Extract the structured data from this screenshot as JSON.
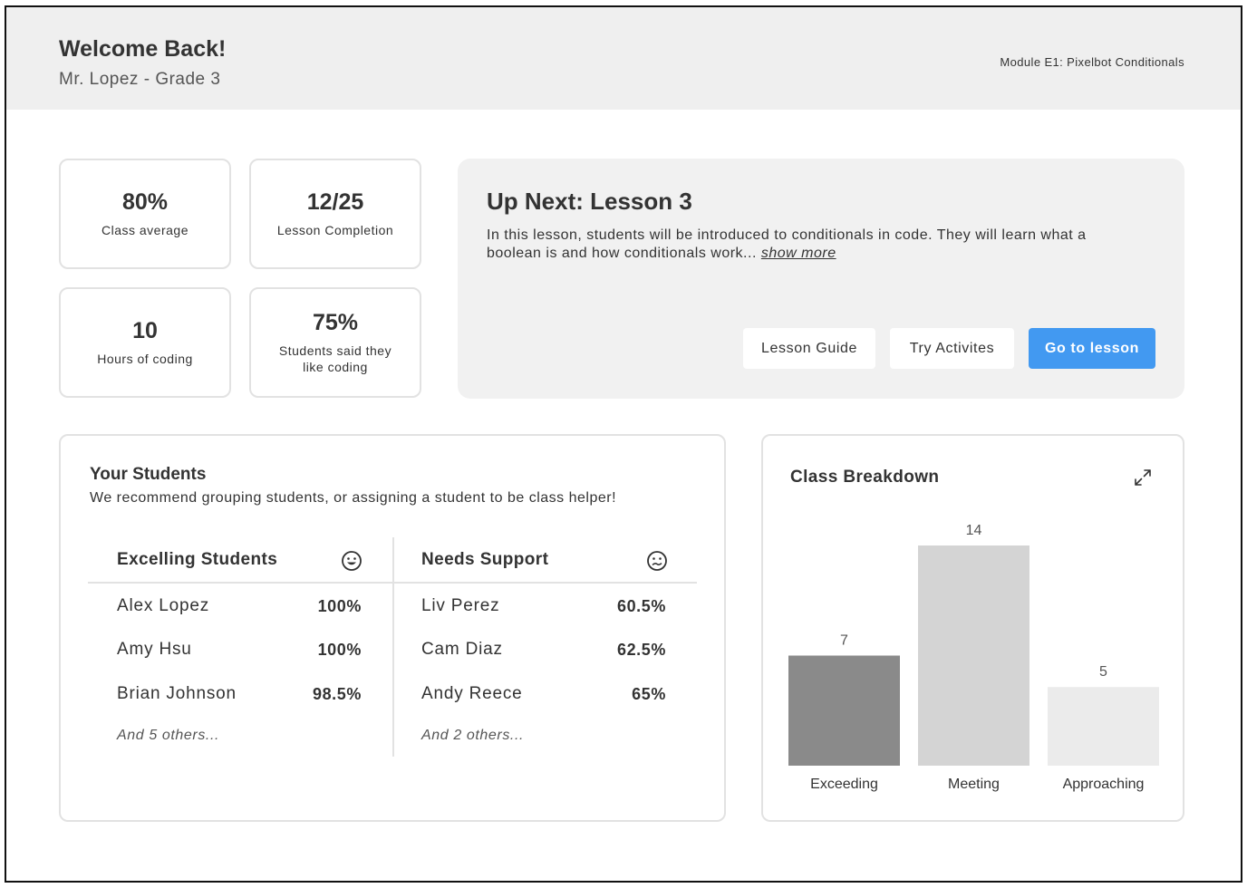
{
  "header": {
    "welcome": "Welcome Back!",
    "subtitle": "Mr. Lopez - Grade 3",
    "module": "Module E1: Pixelbot Conditionals"
  },
  "stats": [
    {
      "value": "80%",
      "label": "Class average"
    },
    {
      "value": "12/25",
      "label": "Lesson Completion"
    },
    {
      "value": "10",
      "label": "Hours of coding"
    },
    {
      "value": "75%",
      "label": "Students said they like coding"
    }
  ],
  "up_next": {
    "title": "Up Next: Lesson 3",
    "description": "In this lesson, students will be introduced to conditionals in code. They will learn what a boolean is and how conditionals work...",
    "show_more": "show more",
    "buttons": {
      "lesson_guide": "Lesson Guide",
      "try_activities": "Try Activites",
      "go_to_lesson": "Go to lesson"
    },
    "primary_color": "#4299f1"
  },
  "students": {
    "title": "Your Students",
    "subtitle": "We recommend grouping students, or assigning a student to be class helper!",
    "excelling": {
      "title": "Excelling Students",
      "icon": "happy-face-icon",
      "rows": [
        {
          "name": "Alex Lopez",
          "value": "100%"
        },
        {
          "name": "Amy Hsu",
          "value": "100%"
        },
        {
          "name": "Brian Johnson",
          "value": "98.5%"
        }
      ],
      "others": "And 5 others..."
    },
    "needs_support": {
      "title": "Needs Support",
      "icon": "confused-face-icon",
      "rows": [
        {
          "name": "Liv Perez",
          "value": "60.5%"
        },
        {
          "name": "Cam Diaz",
          "value": "62.5%"
        },
        {
          "name": "Andy Reece",
          "value": "65%"
        }
      ],
      "others": "And 2 others..."
    }
  },
  "breakdown": {
    "title": "Class Breakdown",
    "expand_icon": "expand-icon"
  },
  "chart_data": {
    "type": "bar",
    "categories": [
      "Exceeding",
      "Meeting",
      "Approaching"
    ],
    "values": [
      7,
      14,
      5
    ],
    "colors": [
      "#8a8a8a",
      "#d4d4d4",
      "#ebebeb"
    ],
    "title": "",
    "xlabel": "",
    "ylabel": "",
    "ylim": [
      0,
      14
    ],
    "grid": false
  }
}
